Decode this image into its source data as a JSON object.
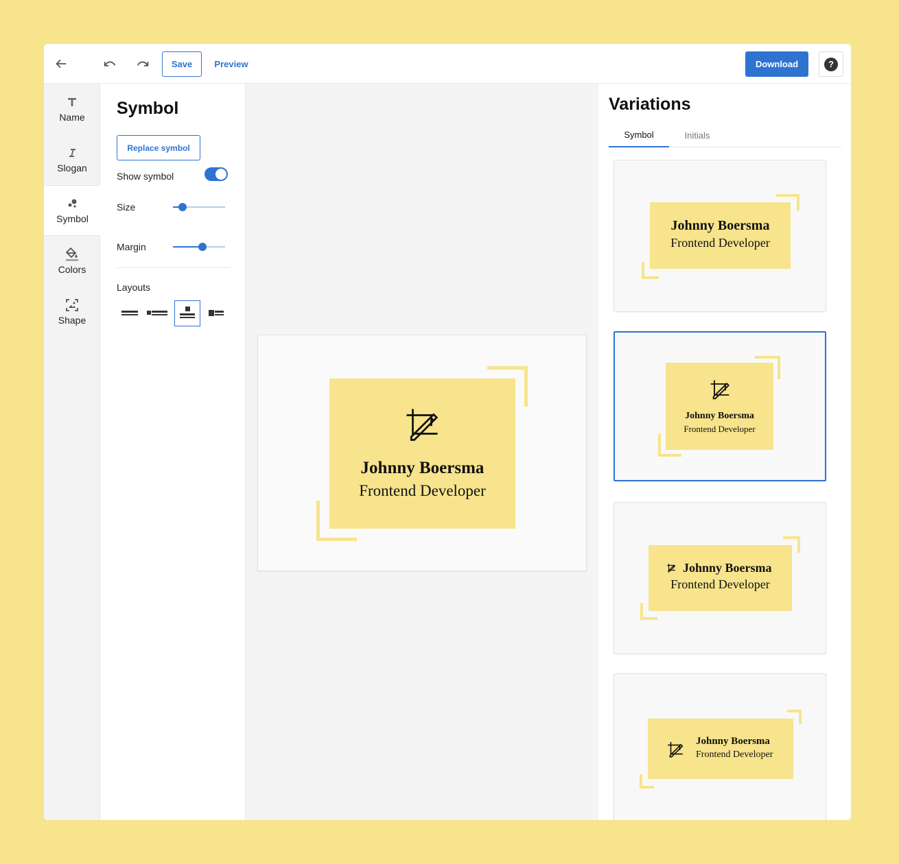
{
  "toolbar": {
    "save_label": "Save",
    "preview_label": "Preview",
    "download_label": "Download",
    "help_label": "?"
  },
  "rail": {
    "items": [
      {
        "label": "Name",
        "icon": "text-icon"
      },
      {
        "label": "Slogan",
        "icon": "italic-icon"
      },
      {
        "label": "Symbol",
        "icon": "symbol-icon",
        "active": true
      },
      {
        "label": "Colors",
        "icon": "paint-bucket-icon"
      },
      {
        "label": "Shape",
        "icon": "shape-icon"
      }
    ]
  },
  "panel": {
    "title": "Symbol",
    "replace_label": "Replace symbol",
    "show_symbol_label": "Show symbol",
    "show_symbol_on": true,
    "size_label": "Size",
    "size_value": 0.18,
    "margin_label": "Margin",
    "margin_value": 0.57,
    "layouts_label": "Layouts",
    "layout_selected": 3
  },
  "logo": {
    "name": "Johnny Boersma",
    "slogan": "Frontend Developer",
    "accent_color": "#f7e48c",
    "symbol": "crop-pencil-icon"
  },
  "variations": {
    "title": "Variations",
    "tabs": [
      {
        "label": "Symbol",
        "active": true
      },
      {
        "label": "Initials",
        "active": false
      }
    ],
    "selected_index": 1
  },
  "colors": {
    "background": "#f7e48c",
    "primary": "#2f73d1"
  }
}
